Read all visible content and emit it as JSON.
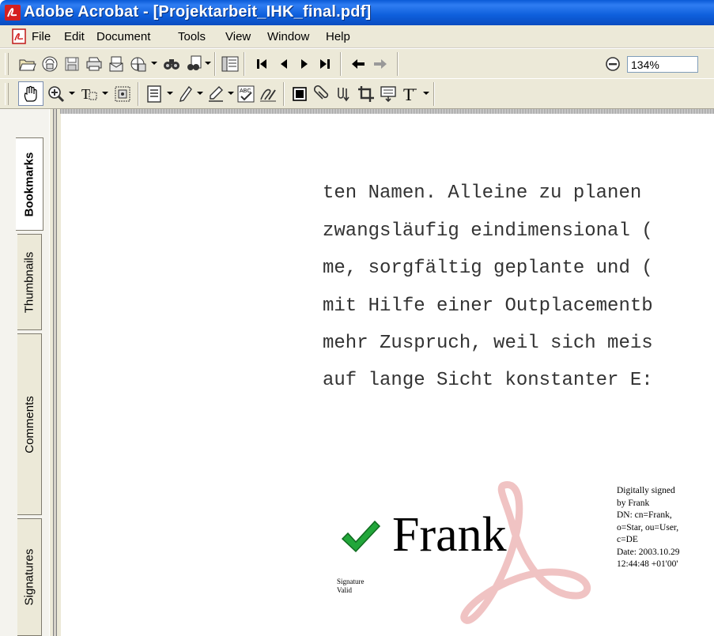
{
  "window": {
    "title": "Adobe Acrobat - [Projektarbeit_IHK_final.pdf]",
    "icon": "acrobat-logo-icon"
  },
  "menu": {
    "items": [
      "File",
      "Edit",
      "Document",
      "Tools",
      "View",
      "Window",
      "Help"
    ]
  },
  "toolbar1": {
    "icons": [
      "open-icon",
      "create-pdf-icon",
      "save-icon",
      "print-icon",
      "email-icon",
      "web-capture-icon",
      "search-icon",
      "find-icon",
      "show-hide-navigation-icon",
      "first-page-icon",
      "previous-page-icon",
      "next-page-icon",
      "last-page-icon",
      "previous-view-icon",
      "next-view-icon",
      "zoom-out-icon"
    ],
    "zoom_value": "134%"
  },
  "toolbar2": {
    "icons": [
      "hand-tool-icon",
      "zoom-in-tool-icon",
      "text-select-tool-icon",
      "graphics-select-icon",
      "note-tool-icon",
      "pencil-tool-icon",
      "highlight-tool-icon",
      "spellcheck-icon",
      "sign-icon",
      "movie-icon",
      "attach-icon",
      "touchup-text-icon",
      "crop-icon",
      "form-tool-icon",
      "touchup-text-tool-icon"
    ]
  },
  "nav_tabs": [
    "Bookmarks",
    "Thumbnails",
    "Comments",
    "Signatures"
  ],
  "document": {
    "lines": [
      "ten Namen. Alleine zu planen",
      "zwangsläufig eindimensional (",
      "me, sorgfältig geplante und (",
      "mit Hilfe einer Outplacementb",
      "mehr Zuspruch, weil sich meis",
      "auf lange Sicht konstanter E:"
    ]
  },
  "signature": {
    "name": "Frank",
    "valid_line1": "Signature",
    "valid_line2": "Valid",
    "details": [
      "Digitally signed",
      "by Frank",
      "DN: cn=Frank,",
      "o=Star, ou=User,",
      "c=DE",
      "Date: 2003.10.29",
      "12:44:48 +01'00'"
    ],
    "check_color": "#22a63a"
  },
  "colors": {
    "titlebar": "#0a5ad6",
    "chrome": "#ece9d8",
    "watermark": "#e9a9a9"
  }
}
